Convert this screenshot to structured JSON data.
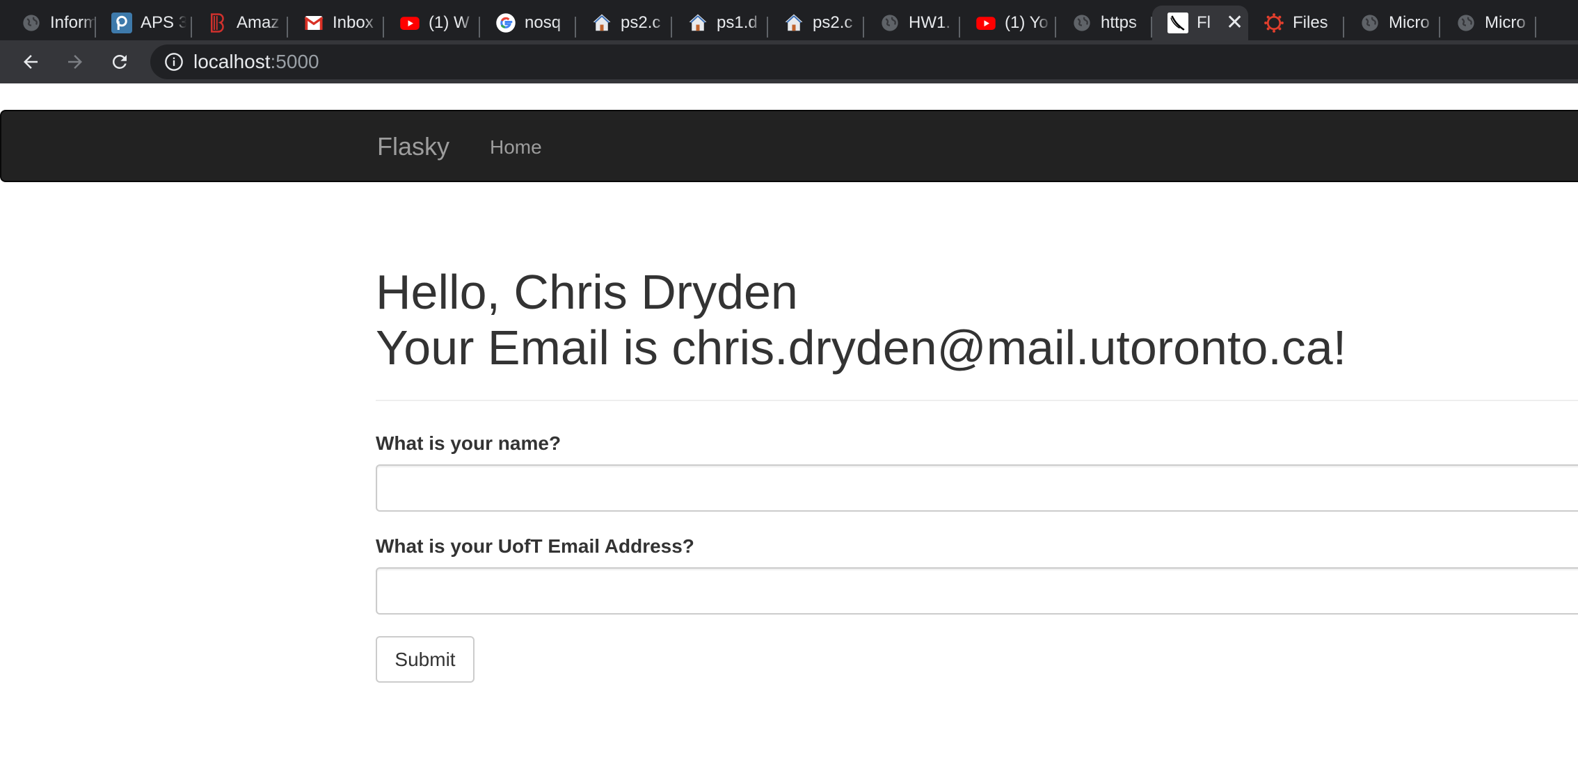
{
  "browser": {
    "tabs": [
      {
        "title": "Inform",
        "icon": "globe-icon",
        "active": false
      },
      {
        "title": "APS 3",
        "icon": "piazza-icon",
        "active": false
      },
      {
        "title": "Amaz",
        "icon": "brand-b-icon",
        "active": false
      },
      {
        "title": "Inbox",
        "icon": "gmail-icon",
        "active": false
      },
      {
        "title": "(1) W",
        "icon": "youtube-icon",
        "active": false
      },
      {
        "title": "nosq",
        "icon": "google-icon",
        "active": false
      },
      {
        "title": "ps2.c",
        "icon": "house-icon",
        "active": false
      },
      {
        "title": "ps1.d",
        "icon": "house-icon",
        "active": false
      },
      {
        "title": "ps2.c",
        "icon": "house-icon",
        "active": false
      },
      {
        "title": "HW1.",
        "icon": "globe-icon",
        "active": false
      },
      {
        "title": "(1) Yo",
        "icon": "youtube-icon",
        "active": false
      },
      {
        "title": "https",
        "icon": "globe-icon",
        "active": false
      },
      {
        "title": "Fl",
        "icon": "flask-icon",
        "active": true
      },
      {
        "title": "Files",
        "icon": "canvas-icon",
        "active": false
      },
      {
        "title": "Micro",
        "icon": "globe-icon",
        "active": false
      },
      {
        "title": "Micro",
        "icon": "globe-icon",
        "active": false
      }
    ],
    "address": {
      "host": "localhost",
      "port": ":5000"
    }
  },
  "navbar": {
    "brand": "Flasky",
    "home": "Home"
  },
  "main": {
    "greeting_line1": "Hello, Chris Dryden",
    "greeting_line2": "Your Email is chris.dryden@mail.utoronto.ca!",
    "form": {
      "name_label": "What is your name?",
      "name_value": "",
      "email_label": "What is your UofT Email Address?",
      "email_value": "",
      "submit_label": "Submit"
    }
  },
  "colors": {
    "tabstrip_bg": "#1f2023",
    "toolbar_bg": "#35363a",
    "navbar_bg": "#222222",
    "text": "#333333",
    "nav_text": "#9d9d9d"
  }
}
